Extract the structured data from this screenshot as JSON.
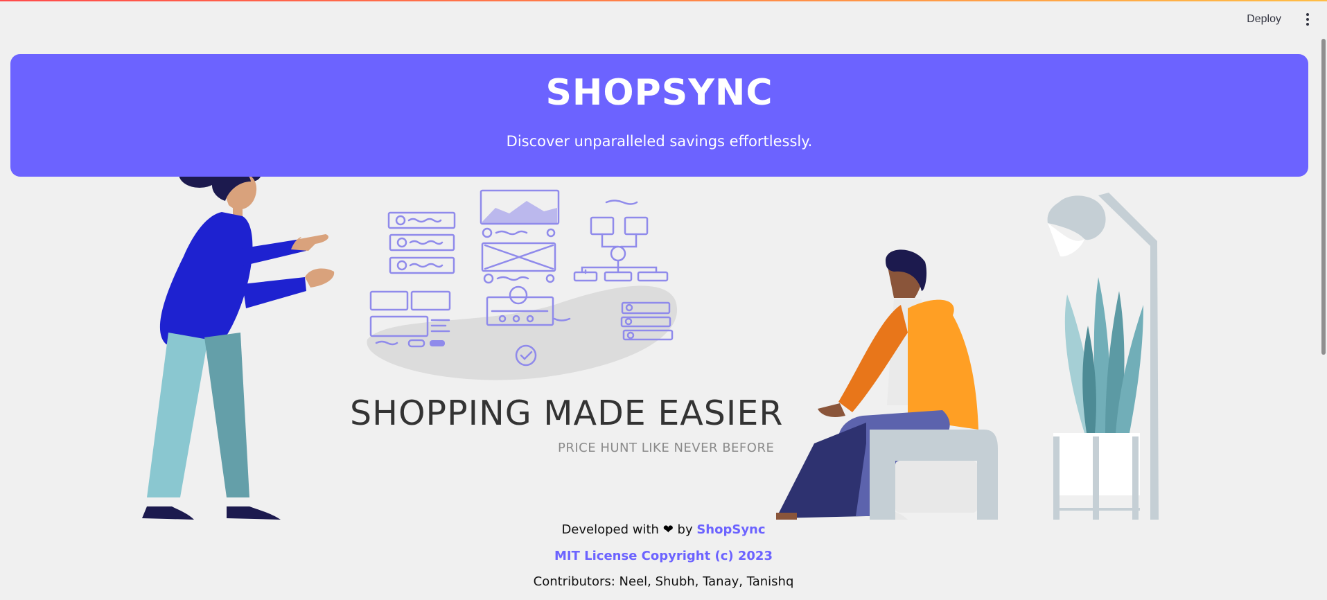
{
  "header": {
    "deploy_label": "Deploy",
    "menu_icon": "more-vert-icon"
  },
  "banner": {
    "title": "SHOPSYNC",
    "subtitle": "Discover unparalleled savings effortlessly.",
    "color": "#6c63ff"
  },
  "hero": {
    "heading": "SHOPPING MADE EASIER",
    "subheading": "PRICE HUNT LIKE NEVER BEFORE"
  },
  "footer": {
    "developed_prefix": "Developed with",
    "heart_icon": "heart-icon",
    "by_text": "by",
    "brand_link": "ShopSync",
    "license_link": "MIT License Copyright (c) 2023",
    "contributors": "Contributors: Neel, Shubh, Tanay, Tanishq"
  },
  "colors": {
    "accent": "#6c63ff",
    "background": "#f0f0f0",
    "wireframe": "#8f8aeb"
  }
}
